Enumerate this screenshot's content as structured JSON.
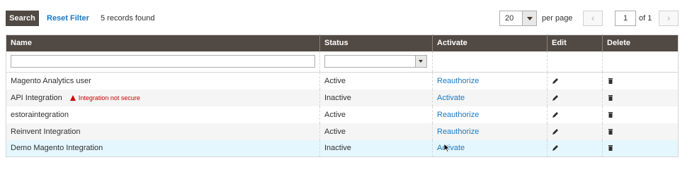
{
  "toolbar": {
    "search_label": "Search",
    "reset_label": "Reset Filter",
    "records_text": "5 records found",
    "per_page_value": "20",
    "per_page_label": "per page",
    "prev_label": "‹",
    "next_label": "›",
    "page_value": "1",
    "page_of": "of 1"
  },
  "grid": {
    "columns": [
      "Name",
      "Status",
      "Activate",
      "Edit",
      "Delete"
    ],
    "rows": [
      {
        "name": "Magento Analytics user",
        "warning": "",
        "status": "Active",
        "action": "Reauthorize"
      },
      {
        "name": "API Integration",
        "warning": "Integration not secure",
        "status": "Inactive",
        "action": "Activate"
      },
      {
        "name": "estoraintegration",
        "warning": "",
        "status": "Active",
        "action": "Reauthorize"
      },
      {
        "name": "Reinvent Integration",
        "warning": "",
        "status": "Active",
        "action": "Reauthorize"
      },
      {
        "name": "Demo Magento Integration",
        "warning": "",
        "status": "Inactive",
        "action": "Activate"
      }
    ]
  },
  "colors": {
    "header_bg": "#514943",
    "link": "#1979c3",
    "warning": "#cc0000",
    "hover_row": "#e5f7fe"
  },
  "icons": {
    "edit": "pencil-icon",
    "delete": "trash-icon",
    "warning": "warning-triangle-icon"
  }
}
